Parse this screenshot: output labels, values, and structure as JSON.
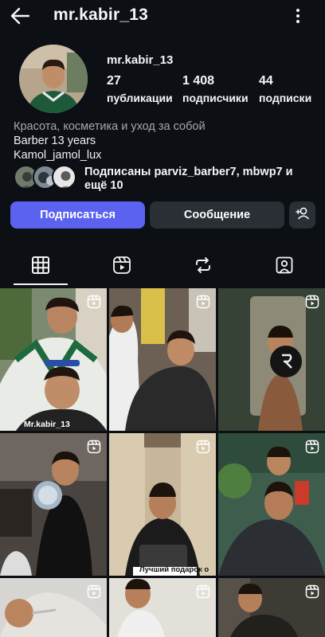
{
  "header": {
    "username": "mr.kabir_13",
    "back_icon": "arrow-left-icon",
    "more_icon": "more-vertical-icon"
  },
  "profile": {
    "name": "mr.kabir_13",
    "stats": [
      {
        "value": "27",
        "label": "публикации"
      },
      {
        "value": "1 408",
        "label": "подписчики"
      },
      {
        "value": "44",
        "label": "подписки"
      }
    ],
    "bio": {
      "category": "Красота, косметика и уход за собой",
      "line1": "Barber 13 years",
      "line2": "Kamol_jamol_lux"
    },
    "followed_by": {
      "line1": "Подписаны parviz_barber7, mbwp7 и",
      "line2": "ещё 10"
    }
  },
  "actions": {
    "follow_label": "Подписаться",
    "message_label": "Сообщение",
    "add_icon": "add-user-icon"
  },
  "tabs": [
    {
      "name": "grid",
      "icon": "grid-icon",
      "active": true
    },
    {
      "name": "reels",
      "icon": "reels-icon",
      "active": false
    },
    {
      "name": "reposts",
      "icon": "repost-icon",
      "active": false
    },
    {
      "name": "tagged",
      "icon": "tagged-icon",
      "active": false
    }
  ],
  "posts": [
    {
      "caption": "Mr.kabir_13",
      "reel": true
    },
    {
      "caption": "",
      "reel": true
    },
    {
      "caption": "",
      "reel": true
    },
    {
      "caption": "",
      "reel": true
    },
    {
      "caption": "Лучший подарок о",
      "reel": true
    },
    {
      "caption": "",
      "reel": true
    },
    {
      "caption": "",
      "reel": true
    },
    {
      "caption": "",
      "reel": true
    },
    {
      "caption": "",
      "reel": true
    }
  ],
  "colors": {
    "background": "#0c0f14",
    "follow_button": "#5b62f0",
    "secondary_button": "#2a2f35",
    "muted_text": "#a8a8a8"
  }
}
